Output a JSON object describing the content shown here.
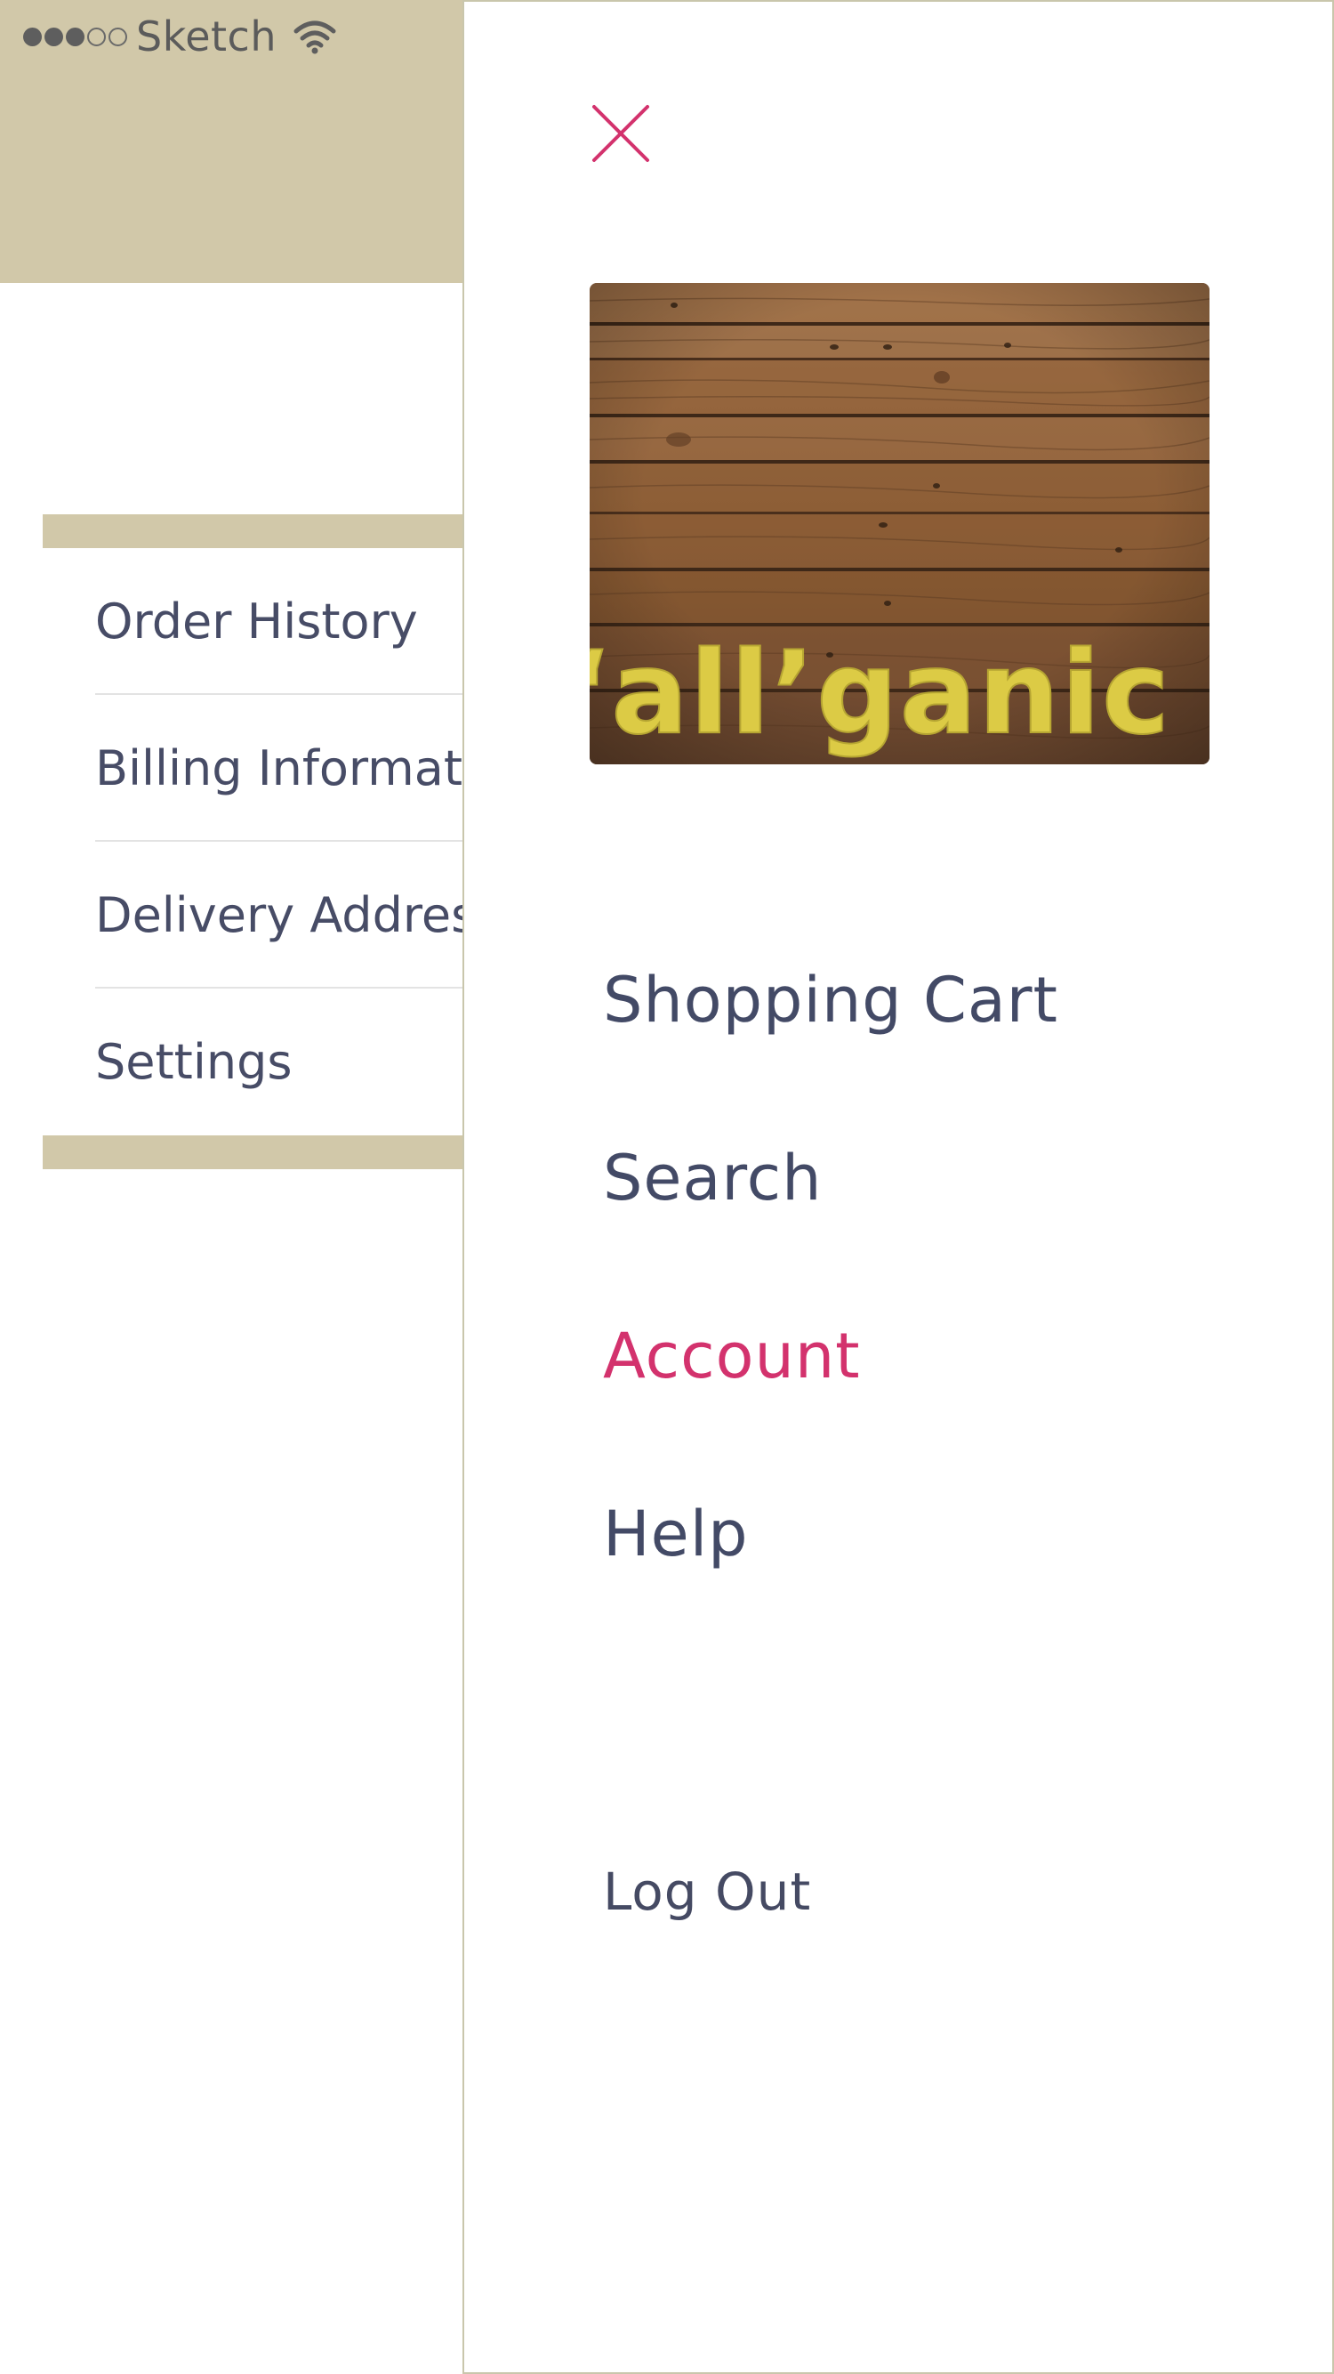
{
  "status_bar": {
    "signal_icon": "signal-dots-icon",
    "carrier": "Sketch",
    "wifi_icon": "wifi-icon"
  },
  "account_menu": {
    "items": [
      {
        "label": "Order History"
      },
      {
        "label": "Billing Information"
      },
      {
        "label": "Delivery Address"
      },
      {
        "label": "Settings"
      }
    ]
  },
  "drawer": {
    "close_icon": "close-icon",
    "logo_text": "‘all’ganic",
    "menu": [
      {
        "label": "Shopping Cart",
        "active": false
      },
      {
        "label": "Search",
        "active": false
      },
      {
        "label": "Account",
        "active": true
      },
      {
        "label": "Help",
        "active": false
      }
    ],
    "logout_label": "Log Out"
  },
  "colors": {
    "header_beige": "#d1c8a9",
    "text_dark": "#454a63",
    "accent_pink": "#d3326d",
    "logo_yellow": "#dccb45",
    "wood_brown": "#8a5a33"
  }
}
